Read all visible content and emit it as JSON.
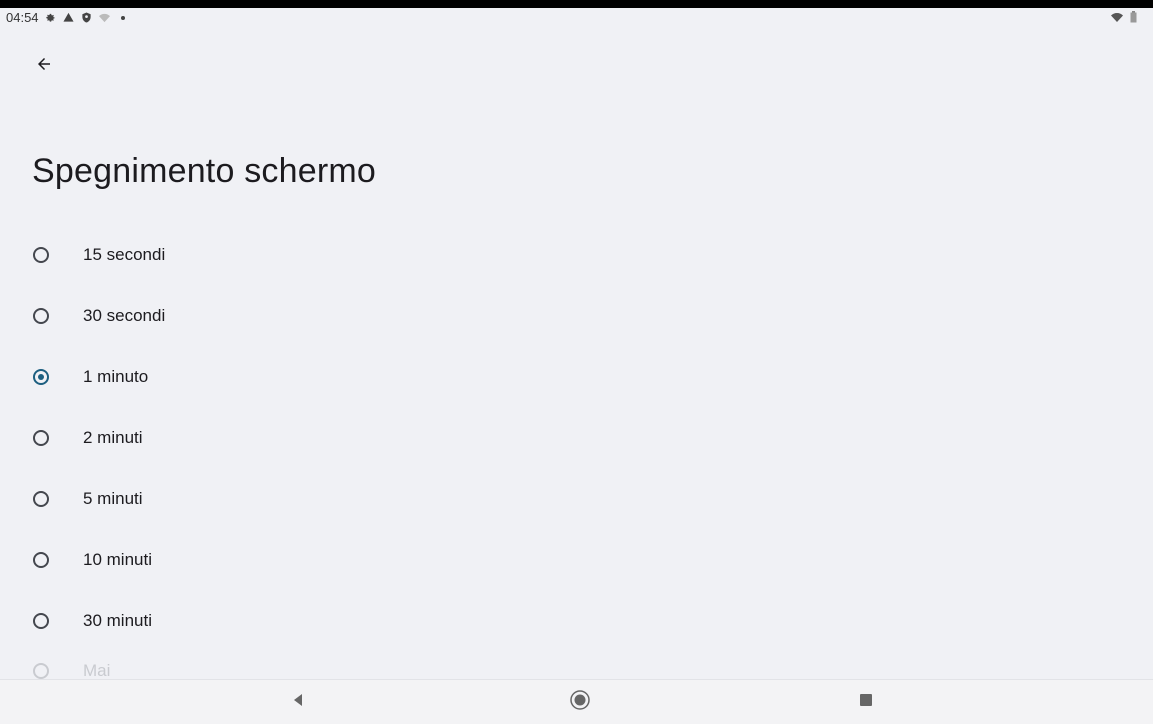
{
  "status_bar": {
    "time": "04:54",
    "icons": [
      "gear-icon",
      "warning-icon",
      "shield-icon",
      "wifi-weak-icon",
      "dot-icon"
    ],
    "right_icons": [
      "wifi-icon",
      "battery-icon"
    ]
  },
  "header": {
    "back_icon": "arrow-left-icon",
    "title": "Spegnimento schermo"
  },
  "options": [
    {
      "label": "15 secondi",
      "selected": false
    },
    {
      "label": "30 secondi",
      "selected": false
    },
    {
      "label": "1 minuto",
      "selected": true
    },
    {
      "label": "2 minuti",
      "selected": false
    },
    {
      "label": "5 minuti",
      "selected": false
    },
    {
      "label": "10 minuti",
      "selected": false
    },
    {
      "label": "30 minuti",
      "selected": false
    },
    {
      "label": "Mai",
      "selected": false
    }
  ],
  "nav_bar": {
    "back": "triangle-back-icon",
    "home": "home-circle-icon",
    "recents": "square-recents-icon"
  },
  "colors": {
    "accent": "#1d5f80",
    "background": "#f0f1f5"
  }
}
